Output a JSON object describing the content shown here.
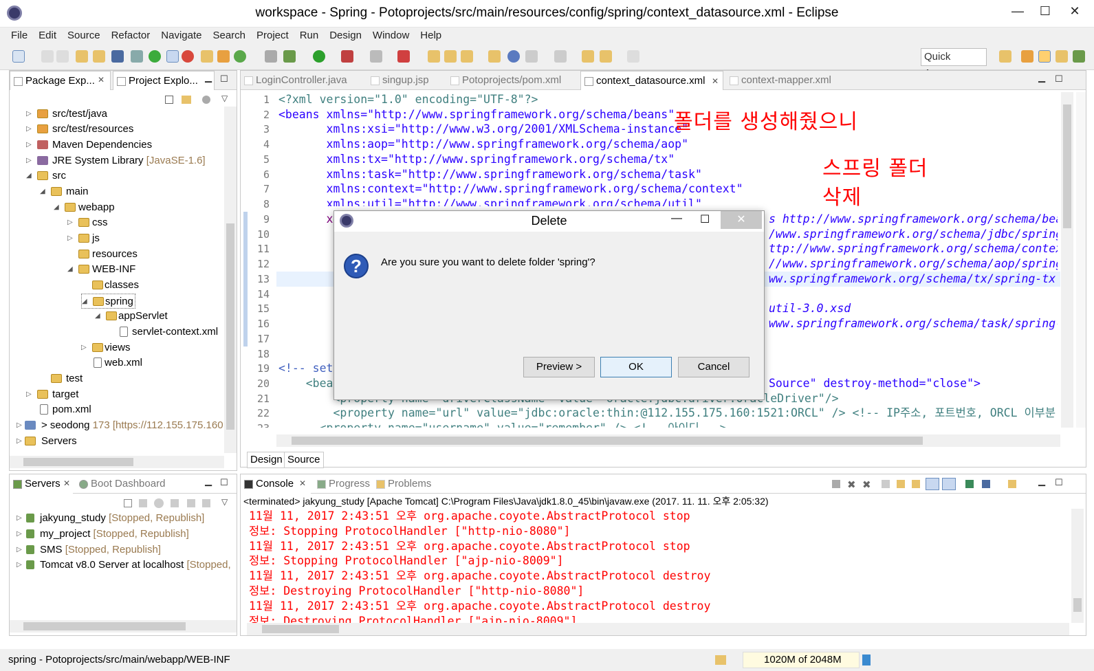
{
  "window": {
    "title": "workspace - Spring - Potoprojects/src/main/resources/config/spring/context_datasource.xml - Eclipse"
  },
  "menu": [
    "File",
    "Edit",
    "Source",
    "Refactor",
    "Navigate",
    "Search",
    "Project",
    "Run",
    "Design",
    "Window",
    "Help"
  ],
  "quick_access": "Quick Access",
  "left_tabs": {
    "package": "Package Exp...",
    "project": "Project Explo..."
  },
  "tree": [
    {
      "label": "src/test/java",
      "extra": ""
    },
    {
      "label": "src/test/resources",
      "extra": ""
    },
    {
      "label": "Maven Dependencies",
      "extra": ""
    },
    {
      "label": "JRE System Library",
      "extra": "[JavaSE-1.6]"
    },
    {
      "label": "src",
      "extra": ""
    },
    {
      "label": "main",
      "extra": ""
    },
    {
      "label": "webapp",
      "extra": ""
    },
    {
      "label": "css",
      "extra": ""
    },
    {
      "label": "js",
      "extra": ""
    },
    {
      "label": "resources",
      "extra": ""
    },
    {
      "label": "WEB-INF",
      "extra": ""
    },
    {
      "label": "classes",
      "extra": ""
    },
    {
      "label": "spring",
      "extra": ""
    },
    {
      "label": "appServlet",
      "extra": ""
    },
    {
      "label": "servlet-context.xml",
      "extra": ""
    },
    {
      "label": "views",
      "extra": ""
    },
    {
      "label": "web.xml",
      "extra": ""
    },
    {
      "label": "test",
      "extra": ""
    },
    {
      "label": "target",
      "extra": ""
    },
    {
      "label": "pom.xml",
      "extra": ""
    },
    {
      "label": "> seodong",
      "extra": "173 [https://112.155.175.160"
    },
    {
      "label": "Servers",
      "extra": ""
    }
  ],
  "servers_tabs": {
    "servers": "Servers",
    "boot": "Boot Dashboard"
  },
  "servers": [
    {
      "name": "jakyung_study",
      "state": "[Stopped, Republish]"
    },
    {
      "name": "my_project",
      "state": "[Stopped, Republish]"
    },
    {
      "name": "SMS",
      "state": "[Stopped, Republish]"
    },
    {
      "name": "Tomcat v8.0 Server at localhost",
      "state": "[Stopped,"
    }
  ],
  "editor_tabs": [
    "LoginController.java",
    "singup.jsp",
    "Potoprojects/pom.xml",
    "context_datasource.xml",
    "context-mapper.xml"
  ],
  "line_numbers": [
    "1",
    "2",
    "3",
    "4",
    "5",
    "6",
    "7",
    "8",
    "9",
    "10",
    "11",
    "12",
    "13",
    "14",
    "15",
    "16",
    "17",
    "18",
    "19",
    "20",
    "21",
    "22",
    "23"
  ],
  "code": {
    "l1": "<?xml version=\"1.0\" encoding=\"UTF-8\"?>",
    "l2": "<beans xmlns=\"http://www.springframework.org/schema/beans\"",
    "l3": "       xmlns:xsi=\"http://www.w3.org/2001/XMLSchema-instance\"",
    "l4": "       xmlns:aop=\"http://www.springframework.org/schema/aop\"",
    "l5": "       xmlns:tx=\"http://www.springframework.org/schema/tx\"",
    "l6": "       xmlns:task=\"http://www.springframework.org/schema/task\"",
    "l7": "       xmlns:context=\"http://www.springframework.org/schema/context\"",
    "l8": "       xmlns:util=\"http://www.springframework.org/schema/util\"",
    "l9": "       xs",
    "r9": "s http://www.springframework.org/schema/bea",
    "r10": "/www.springframework.org/schema/jdbc/spring",
    "r11": "ttp://www.springframework.org/schema/contex",
    "r12": "//www.springframework.org/schema/aop/spring",
    "r13": "ww.springframework.org/schema/tx/spring-tx.",
    "r15": "util-3.0.xsd",
    "r16": "www.springframework.org/schema/task/spring-",
    "l19": "<!-- set",
    "l20": "    <bea",
    "r20": "Source\" destroy-method=\"close\">",
    "l21": "        <property name=\"driverClassName\" value=\"oracle.jdbc.driver.OracleDriver\"/>",
    "l22": "        <property name=\"url\" value=\"jdbc:oracle:thin:@112.155.175.160:1521:ORCL\" /> <!-- IP주소, 포트번호, ORCL 이부분",
    "l23": "      <property name=\"username\" value=\"remember\" /> <!-- 아이디 -->"
  },
  "annotation": {
    "line1": "폴더를 생성해줬으니",
    "line2": "스프링 폴더",
    "line3": "삭제"
  },
  "design_tabs": {
    "design": "Design",
    "source": "Source"
  },
  "bottom_tabs": {
    "console": "Console",
    "progress": "Progress",
    "problems": "Problems"
  },
  "console_header": "<terminated> jakyung_study [Apache Tomcat] C:\\Program Files\\Java\\jdk1.8.0_45\\bin\\javaw.exe (2017. 11. 11. 오후 2:05:32)",
  "console_lines": [
    "11월 11, 2017 2:43:51 오후 org.apache.coyote.AbstractProtocol stop",
    "정보: Stopping ProtocolHandler [\"http-nio-8080\"]",
    "11월 11, 2017 2:43:51 오후 org.apache.coyote.AbstractProtocol stop",
    "정보: Stopping ProtocolHandler [\"ajp-nio-8009\"]",
    "11월 11, 2017 2:43:51 오후 org.apache.coyote.AbstractProtocol destroy",
    "정보: Destroying ProtocolHandler [\"http-nio-8080\"]",
    "11월 11, 2017 2:43:51 오후 org.apache.coyote.AbstractProtocol destroy",
    "정보: Destroying ProtocolHandler [\"ajp-nio-8009\"]"
  ],
  "dialog": {
    "title": "Delete",
    "message": "Are you sure you want to delete folder 'spring'?",
    "preview": "Preview >",
    "ok": "OK",
    "cancel": "Cancel"
  },
  "status": {
    "path": "spring - Potoprojects/src/main/webapp/WEB-INF",
    "memory": "1020M of 2048M"
  },
  "colors": {
    "console_text": "#ff0000",
    "annotation": "#ff0000",
    "xml_string": "#2a00ff",
    "xml_attr": "#7f007f",
    "xml_tag": "#3f7f7f"
  }
}
